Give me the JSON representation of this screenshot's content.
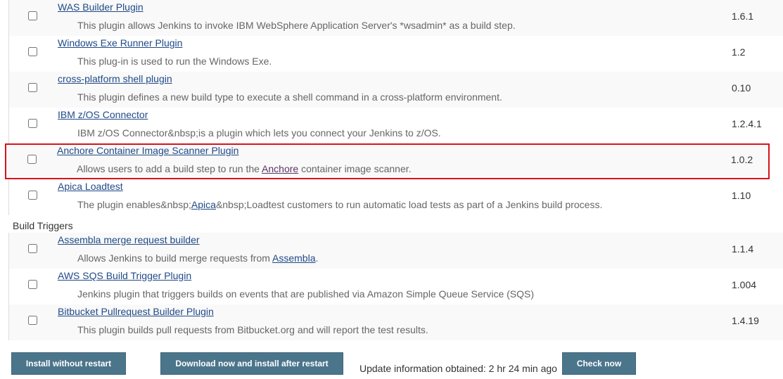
{
  "sections": {
    "top_rows": [
      {
        "name": "WAS Builder Plugin",
        "desc": "This plugin allows Jenkins to invoke IBM WebSphere Application Server's *wsadmin* as a build step.",
        "version": "1.6.1"
      },
      {
        "name": "Windows Exe Runner Plugin",
        "desc": "This plug-in is used to run the Windows Exe.",
        "version": "1.2"
      },
      {
        "name": "cross-platform shell plugin",
        "desc": "This plugin defines a new build type to execute a shell command in a cross-platform environment.",
        "version": "0.10"
      },
      {
        "name": "IBM z/OS Connector",
        "desc": "IBM z/OS Connector&nbsp;is a plugin which lets you connect your Jenkins to z/OS.",
        "version": "1.2.4.1"
      },
      {
        "name": "Anchore Container Image Scanner Plugin",
        "desc_before": "Allows users to add a build step to run the ",
        "desc_link": "Anchore",
        "desc_after": " container image scanner.",
        "version": "1.0.2"
      },
      {
        "name": "Apica Loadtest",
        "desc_before": "The plugin enables&nbsp;",
        "desc_link": "Apica",
        "desc_after": "&nbsp;Loadtest customers to run automatic load tests as part of a Jenkins build process.",
        "version": "1.10"
      }
    ],
    "build_triggers": {
      "label": "Build Triggers",
      "rows": [
        {
          "name": "Assembla merge request builder",
          "desc_before": "Allows Jenkins to build merge requests from ",
          "desc_link": "Assembla",
          "desc_after": ".",
          "version": "1.1.4"
        },
        {
          "name": "AWS SQS Build Trigger Plugin",
          "desc": "Jenkins plugin that triggers builds on events that are published via Amazon Simple Queue Service (SQS)",
          "version": "1.004"
        },
        {
          "name": "Bitbucket Pullrequest Builder Plugin",
          "desc": "This plugin builds pull requests from Bitbucket.org and will report the test results.",
          "version": "1.4.19"
        }
      ]
    }
  },
  "footer": {
    "install_without_restart": "Install without restart",
    "download_install_after_restart": "Download now and install after restart",
    "update_info": "Update information obtained: 2 hr 24 min ago",
    "check_now": "Check now"
  },
  "colors": {
    "link": "#204a87",
    "button_bg": "#4b758b",
    "highlight_border": "#d6141a",
    "row_shade": "#f9f9f9"
  }
}
